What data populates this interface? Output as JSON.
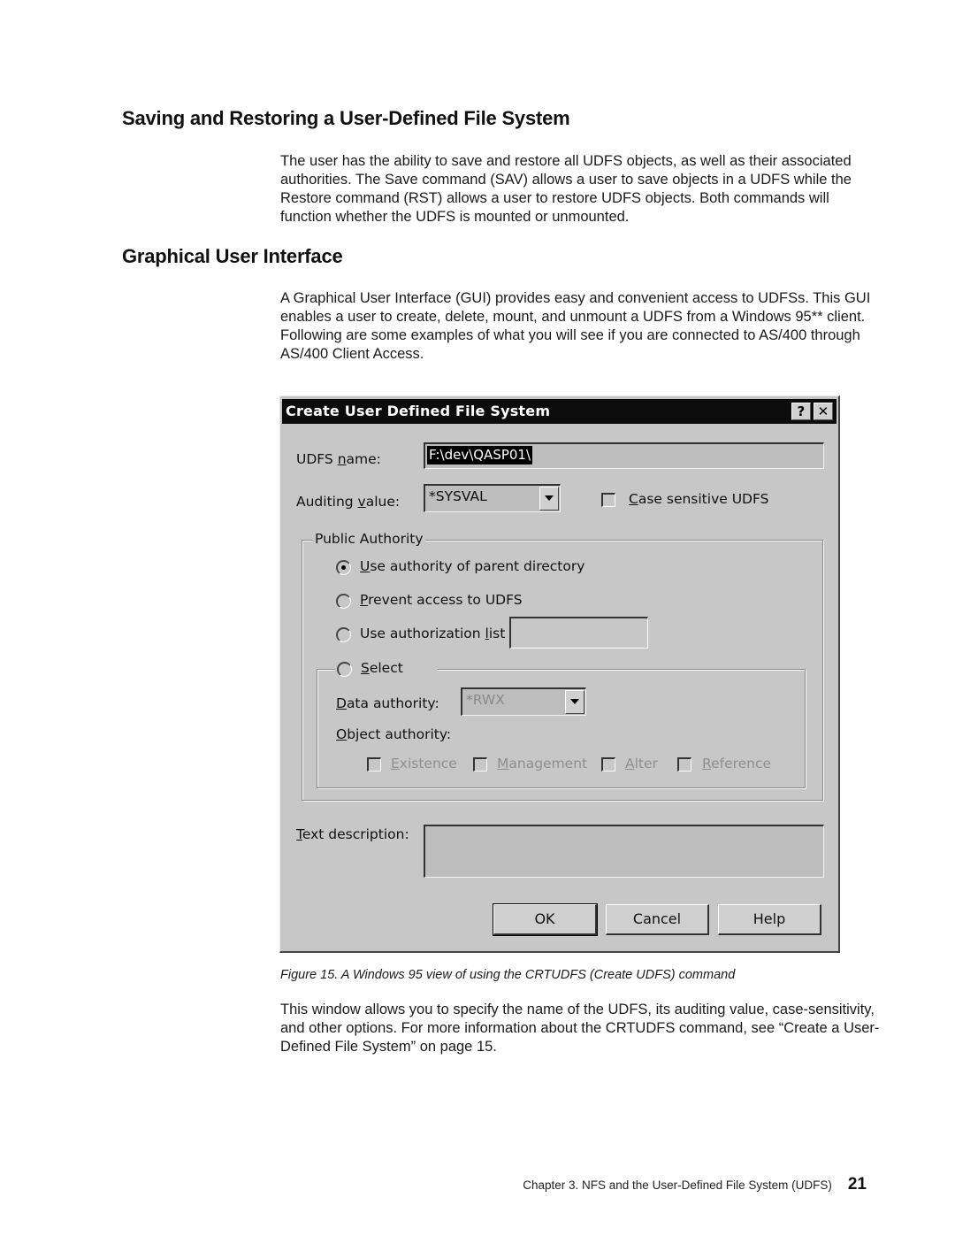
{
  "sections": {
    "save_restore": {
      "heading": "Saving and Restoring a User-Defined File System",
      "paragraph": "The user has the ability to save and restore all UDFS objects, as well as their associated authorities. The Save command (SAV) allows a user to save objects in a UDFS while the Restore command (RST) allows a user to restore UDFS objects. Both commands will function whether the UDFS is mounted or unmounted."
    },
    "gui": {
      "heading": "Graphical User Interface",
      "paragraph": "A Graphical User Interface (GUI) provides easy and convenient access to UDFSs. This GUI enables a user to create, delete, mount, and unmount a UDFS from a Windows 95** client. Following are some examples of what you will see if you are connected to AS/400 through AS/400 Client Access."
    }
  },
  "dialog": {
    "title": "Create User Defined File System",
    "help_glyph": "?",
    "close_glyph": "✕",
    "udfs_name": {
      "label_pre": "UDFS ",
      "label_ul": "n",
      "label_post": "ame:",
      "value": "F:\\dev\\QASP01\\"
    },
    "auditing": {
      "label_pre": "Auditing ",
      "label_ul": "v",
      "label_post": "alue:",
      "value": "*SYSVAL"
    },
    "case_sensitive": {
      "label_ul": "C",
      "label_post": "ase sensitive UDFS",
      "checked": false
    },
    "public_authority": {
      "title": "Public Authority",
      "options": [
        {
          "ul": "U",
          "rest": "se authority of parent directory",
          "selected": true
        },
        {
          "ul": "P",
          "rest": "revent access to  UDFS",
          "selected": false
        },
        {
          "pre": "Use authorization ",
          "ul": "l",
          "rest": "ist",
          "selected": false
        }
      ],
      "authorization_list_value": "",
      "select": {
        "ul": "S",
        "rest": "elect",
        "selected": false,
        "data_authority": {
          "ul": "D",
          "rest": "ata authority:",
          "value": "*RWX"
        },
        "object_authority": {
          "ul": "O",
          "rest": "bject authority:"
        },
        "object_checks": [
          {
            "ul": "E",
            "rest": "xistence",
            "checked": false
          },
          {
            "ul": "M",
            "rest": "anagement",
            "checked": false
          },
          {
            "ul": "A",
            "rest": "lter",
            "checked": false
          },
          {
            "ul": "R",
            "rest": "eference",
            "checked": false
          }
        ]
      }
    },
    "text_description": {
      "ul": "T",
      "rest": "ext description:",
      "value": ""
    },
    "buttons": {
      "ok": "OK",
      "cancel": "Cancel",
      "help": "Help"
    }
  },
  "figure_caption": "Figure 15. A Windows 95 view of using the CRTUDFS (Create UDFS) command",
  "after_paragraph": "This window allows you to specify the name of the UDFS, its auditing value, case-sensitivity, and other options. For more information about the CRTUDFS command, see “Create a User-Defined File System” on page 15.",
  "footer": {
    "chapter": "Chapter 3. NFS and the User-Defined File System (UDFS)",
    "page_number": "21"
  }
}
